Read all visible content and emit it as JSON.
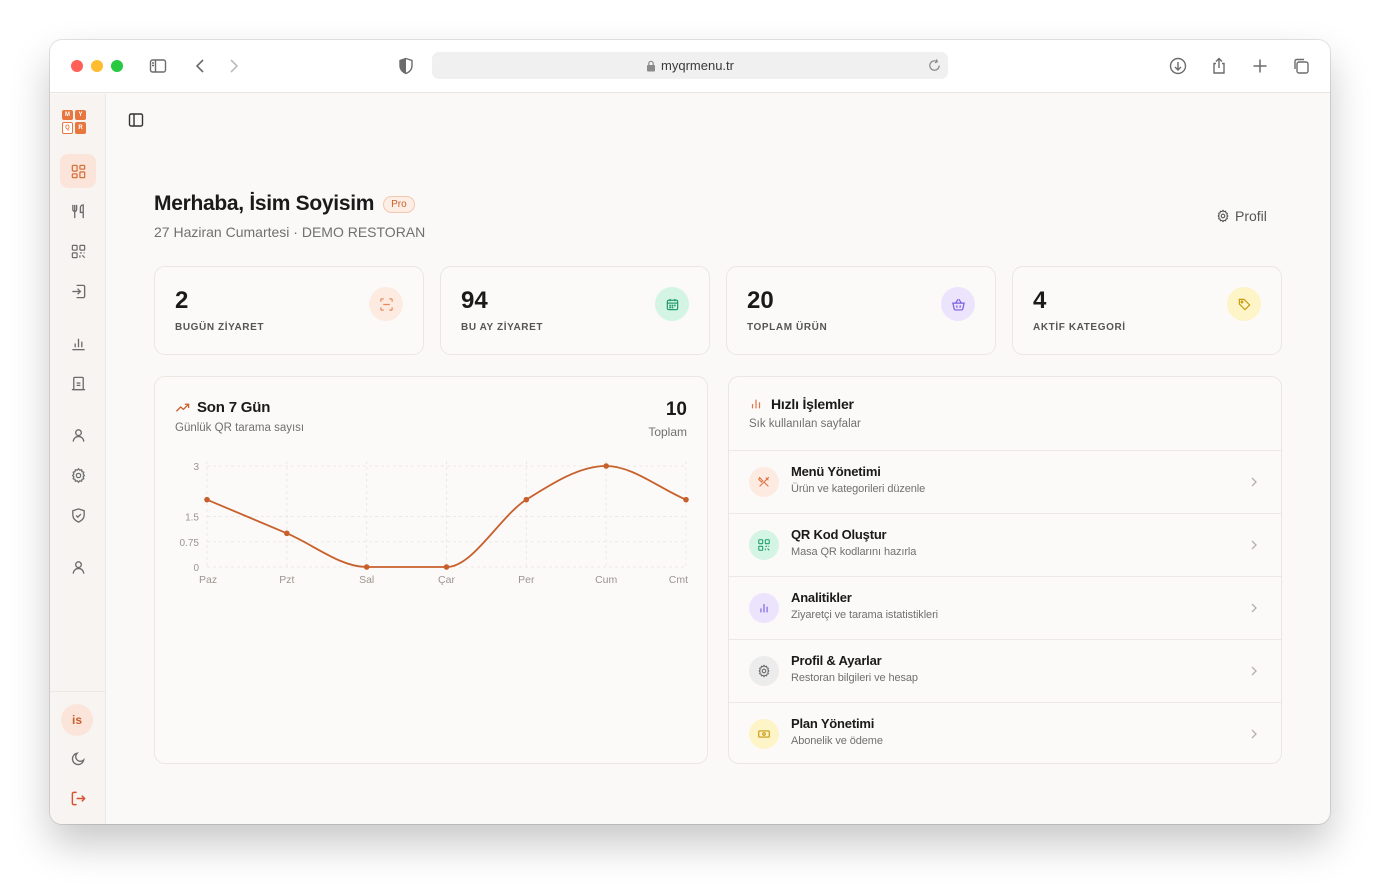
{
  "browser": {
    "url": "myqrmenu.tr"
  },
  "logo": {
    "letters": [
      "M",
      "Y",
      "Q",
      "R"
    ]
  },
  "sidebar": {
    "items": [
      {
        "name": "dashboard",
        "icon": "grid-icon",
        "active": true
      },
      {
        "name": "menu",
        "icon": "utensils-icon"
      },
      {
        "name": "qr-codes",
        "icon": "qr-code-icon"
      },
      {
        "name": "import",
        "icon": "import-icon"
      },
      {
        "name": "analytics",
        "icon": "bar-chart-icon"
      },
      {
        "name": "restaurants",
        "icon": "building-icon"
      },
      {
        "name": "users",
        "icon": "user-icon"
      },
      {
        "name": "settings",
        "icon": "gear-icon"
      },
      {
        "name": "security",
        "icon": "shield-check-icon"
      },
      {
        "name": "account",
        "icon": "user-icon"
      }
    ],
    "avatar_initials": "is",
    "theme_icon": "moon-icon",
    "logout_icon": "logout-icon"
  },
  "header": {
    "greeting": "Merhaba, İsim Soyisim",
    "plan_badge": "Pro",
    "subtitle": "27 Haziran Cumartesi · DEMO RESTORAN",
    "profile_label": "Profil"
  },
  "stats": [
    {
      "value": "2",
      "label": "BUGÜN ZİYARET",
      "icon": "scan-icon",
      "color": "#e8895b",
      "bg": "#fdebe2"
    },
    {
      "value": "94",
      "label": "BU AY ZİYARET",
      "icon": "calendar-icon",
      "color": "#1f9d6b",
      "bg": "#d4f4e4"
    },
    {
      "value": "20",
      "label": "TOPLAM ÜRÜN",
      "icon": "basket-icon",
      "color": "#7c5ce0",
      "bg": "#ebe4fc"
    },
    {
      "value": "4",
      "label": "AKTİF KATEGORİ",
      "icon": "tag-icon",
      "color": "#c99a10",
      "bg": "#fdf4c8"
    }
  ],
  "chart_card": {
    "title": "Son 7 Gün",
    "subtitle": "Günlük QR tarama sayısı",
    "total_value": "10",
    "total_label": "Toplam",
    "accent": "#c8602c"
  },
  "chart_data": {
    "type": "line",
    "categories": [
      "Paz",
      "Pzt",
      "Sal",
      "Çar",
      "Per",
      "Cum",
      "Cmt"
    ],
    "values": [
      2,
      1,
      0,
      0,
      2,
      3,
      2
    ],
    "y_ticks": [
      "0",
      "0.75",
      "1.5",
      "3"
    ],
    "ylim": [
      0,
      3
    ],
    "grid": true
  },
  "quick_actions": {
    "title": "Hızlı İşlemler",
    "subtitle": "Sık kullanılan sayfalar",
    "items": [
      {
        "title": "Menü Yönetimi",
        "desc": "Ürün ve kategorileri düzenle",
        "icon": "utensils-crossed-icon",
        "color": "#e0744a",
        "bg": "#fdebe2"
      },
      {
        "title": "QR Kod Oluştur",
        "desc": "Masa QR kodlarını hazırla",
        "icon": "qr-code-icon",
        "color": "#1f9d6b",
        "bg": "#d4f4e4"
      },
      {
        "title": "Analitikler",
        "desc": "Ziyaretçi ve tarama istatistikleri",
        "icon": "bar-chart-icon",
        "color": "#7c5ce0",
        "bg": "#ebe4fc"
      },
      {
        "title": "Profil & Ayarlar",
        "desc": "Restoran bilgileri ve hesap",
        "icon": "gear-icon",
        "color": "#6b6b6b",
        "bg": "#ececec"
      },
      {
        "title": "Plan Yönetimi",
        "desc": "Abonelik ve ödeme",
        "icon": "banknote-icon",
        "color": "#c99a10",
        "bg": "#fdf4c8"
      }
    ]
  }
}
